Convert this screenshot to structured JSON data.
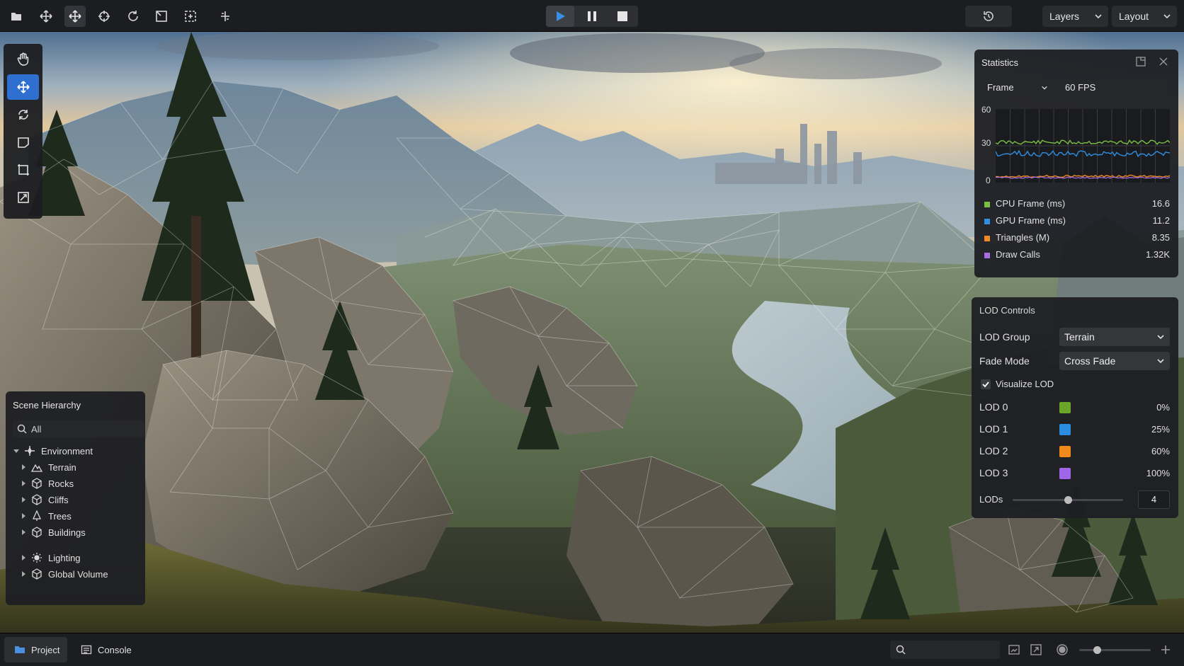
{
  "topbar": {
    "tools": [
      {
        "icon": "folder-open-icon"
      },
      {
        "icon": "move-arrows-icon"
      },
      {
        "icon": "move-arrows-icon",
        "active": true
      },
      {
        "icon": "crosshair-icon"
      },
      {
        "icon": "rotate-icon"
      },
      {
        "icon": "scale-box-icon"
      },
      {
        "icon": "snap-grid-icon"
      },
      {
        "icon": "pivot-icon"
      }
    ],
    "playback": {
      "play_icon": "play-icon",
      "pause_icon": "pause-icon",
      "stop_icon": "stop-icon"
    },
    "history_icon": "history-icon",
    "layers_label": "Layers",
    "layout_label": "Layout"
  },
  "toolstrip": {
    "tools": [
      "hand-icon",
      "move-icon",
      "rotate-icon",
      "rect-select-icon",
      "scale-icon",
      "transform-icon"
    ],
    "active_index": 1
  },
  "statistics": {
    "title": "Statistics",
    "mode": "Frame",
    "fps": "60 FPS",
    "axis": {
      "top": "60",
      "mid": "30",
      "bottom": "0"
    },
    "rows": [
      {
        "label": "CPU Frame (ms)",
        "value": "16.6",
        "color": "#7bc043"
      },
      {
        "label": "GPU Frame (ms)",
        "value": "11.2",
        "color": "#2f8ee0"
      },
      {
        "label": "Triangles (M)",
        "value": "8.35",
        "color": "#f08a24"
      },
      {
        "label": "Draw Calls",
        "value": "1.32K",
        "color": "#a56ee6"
      }
    ]
  },
  "lod_controls": {
    "title": "LOD Controls",
    "lod_group_label": "LOD Group",
    "lod_group_value": "Terrain",
    "fade_mode_label": "Fade Mode",
    "fade_mode_value": "Cross Fade",
    "visualize_label": "Visualize LOD",
    "visualize_checked": true,
    "levels": [
      {
        "label": "LOD 0",
        "percent": "0%",
        "color": "#6aa628"
      },
      {
        "label": "LOD 1",
        "percent": "25%",
        "color": "#2b8de0"
      },
      {
        "label": "LOD 2",
        "percent": "60%",
        "color": "#f0891c"
      },
      {
        "label": "LOD 3",
        "percent": "100%",
        "color": "#a066e8"
      }
    ],
    "lods_label": "LODs",
    "lods_value": "4",
    "lods_slider_fraction": 0.5
  },
  "hierarchy": {
    "title": "Scene Hierarchy",
    "search_placeholder": "All",
    "items": [
      {
        "label": "Environment",
        "icon": "environment-icon"
      },
      {
        "label": "Terrain",
        "icon": "terrain-icon"
      },
      {
        "label": "Rocks",
        "icon": "cube-icon"
      },
      {
        "label": "Cliffs",
        "icon": "cube-icon"
      },
      {
        "label": "Trees",
        "icon": "tree-icon"
      },
      {
        "label": "Buildings",
        "icon": "cube-icon"
      },
      {
        "label": "Lighting",
        "icon": "sun-icon"
      },
      {
        "label": "Global Volume",
        "icon": "cube-icon"
      }
    ]
  },
  "bottombar": {
    "project_label": "Project",
    "console_label": "Console",
    "zoom_fraction": 0.25
  }
}
